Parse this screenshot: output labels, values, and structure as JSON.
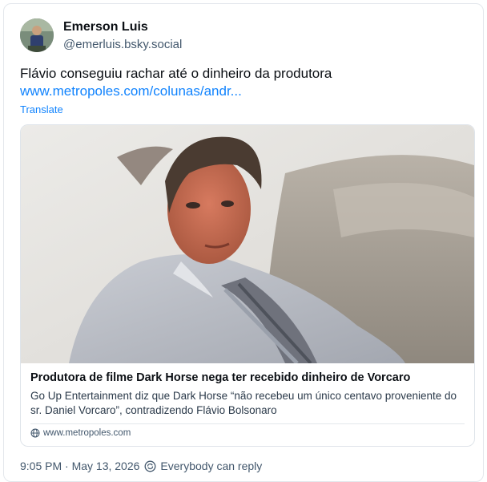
{
  "author": {
    "name": "Emerson Luis",
    "handle": "@emerluis.bsky.social"
  },
  "post": {
    "text": "Flávio conseguiu rachar até o dinheiro da produtora",
    "link_text": "www.metropoles.com/colunas/andr...",
    "translate_label": "Translate"
  },
  "embed": {
    "title": "Produtora de filme Dark Horse nega ter recebido dinheiro de Vorcaro",
    "description": "Go Up Entertainment diz que Dark Horse “não recebeu um único centavo proveniente do sr. Daniel Vorcaro”, contradizendo Flávio Bolsonaro",
    "domain": "www.metropoles.com"
  },
  "footer": {
    "timestamp": "9:05 PM · May 13, 2026",
    "reply_setting": "Everybody can reply"
  },
  "icons": {
    "globe": "globe-icon",
    "reply_settings": "reply-settings-icon"
  },
  "colors": {
    "link": "#1083fe",
    "secondary_text": "#42576c"
  }
}
